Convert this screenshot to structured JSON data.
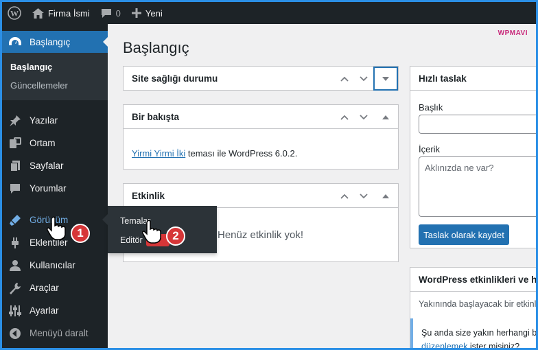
{
  "adminbar": {
    "site_name": "Firma İsmi",
    "comment_count": "0",
    "new_label": "Yeni"
  },
  "sidebar": {
    "current": {
      "label": "Başlangıç",
      "icon": "dashboard-icon"
    },
    "submenu": [
      "Başlangıç",
      "Güncellemeler"
    ],
    "items": [
      {
        "label": "Yazılar",
        "icon": "pin-icon"
      },
      {
        "label": "Ortam",
        "icon": "media-icon"
      },
      {
        "label": "Sayfalar",
        "icon": "pages-icon"
      },
      {
        "label": "Yorumlar",
        "icon": "comments-icon"
      },
      {
        "label": "Görünüm",
        "icon": "appearance-icon"
      },
      {
        "label": "Eklentiler",
        "icon": "plugins-icon"
      },
      {
        "label": "Kullanıcılar",
        "icon": "users-icon"
      },
      {
        "label": "Araçlar",
        "icon": "tools-icon"
      },
      {
        "label": "Ayarlar",
        "icon": "settings-icon"
      }
    ],
    "collapse_label": "Menüyü daralt"
  },
  "flyout": {
    "themes": "Temalar",
    "editor": "Editör"
  },
  "annotations": {
    "step1": "1",
    "step2": "2"
  },
  "main": {
    "page_title": "Başlangıç",
    "brand": "WPMAVI",
    "site_health": {
      "title": "Site sağlığı durumu"
    },
    "at_a_glance": {
      "title": "Bir bakışta",
      "theme_link": "Yirmi Yirmi İki",
      "theme_text": "teması ile WordPress 6.0.2."
    },
    "activity": {
      "title": "Etkinlik",
      "empty": "Henüz etkinlik yok!"
    },
    "quick_draft": {
      "title": "Hızlı taslak",
      "title_label": "Başlık",
      "content_label": "İçerik",
      "content_placeholder": "Aklınızda ne var?",
      "save_button": "Taslak olarak kaydet"
    },
    "events": {
      "title": "WordPress etkinlikleri ve hal",
      "subtitle": "Yakınında başlayacak bir etkinlik",
      "notice_line1": "Şu anda size yakın herhangi bi",
      "notice_link": "düzenlemek",
      "notice_line2": "ister misiniz?"
    }
  },
  "colors": {
    "accent": "#2271b1",
    "adminbar": "#1d2327",
    "badge": "#d63638",
    "frame": "#2b8fe6"
  }
}
